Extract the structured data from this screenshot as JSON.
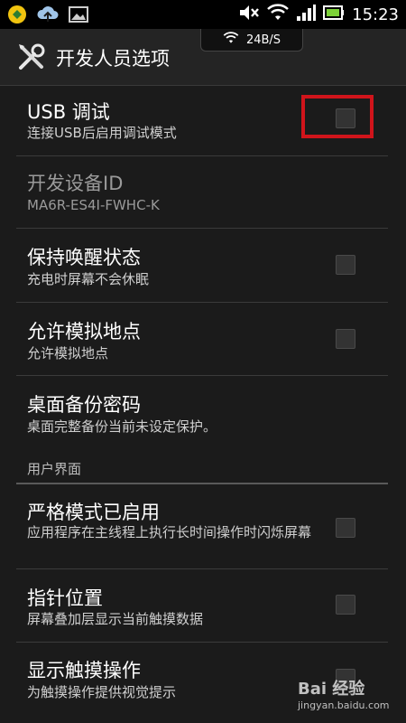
{
  "status_bar": {
    "time": "15:23",
    "left_icons": [
      "app-notification-icon",
      "cloud-upload-icon",
      "image-icon"
    ],
    "right_icons": [
      "mute-icon",
      "wifi-icon",
      "signal-icon",
      "battery-icon"
    ]
  },
  "net_speed": "24B/S",
  "action_bar": {
    "title": "开发人员选项"
  },
  "items": [
    {
      "title": "USB 调试",
      "sub": "连接USB后启用调试模式",
      "checkbox": true
    },
    {
      "title": "开发设备ID",
      "sub": "MA6R-ES4I-FWHC-K",
      "checkbox": false,
      "disabled": true
    },
    {
      "title": "保持唤醒状态",
      "sub": "充电时屏幕不会休眠",
      "checkbox": true
    },
    {
      "title": "允许模拟地点",
      "sub": "允许模拟地点",
      "checkbox": true
    },
    {
      "title": "桌面备份密码",
      "sub": "桌面完整备份当前未设定保护。",
      "checkbox": false
    }
  ],
  "section_header": "用户界面",
  "items2": [
    {
      "title": "严格模式已启用",
      "sub": "应用程序在主线程上执行长时间操作时闪烁屏幕",
      "checkbox": true
    },
    {
      "title": "指针位置",
      "sub": "屏幕叠加层显示当前触摸数据",
      "checkbox": true
    },
    {
      "title": "显示触摸操作",
      "sub": "为触摸操作提供视觉提示",
      "checkbox": true
    }
  ],
  "watermark": {
    "brand": "Bai 经验",
    "url": "jingyan.baidu.com"
  },
  "colors": {
    "highlight": "#d0141b",
    "background": "#1b1b1b"
  }
}
